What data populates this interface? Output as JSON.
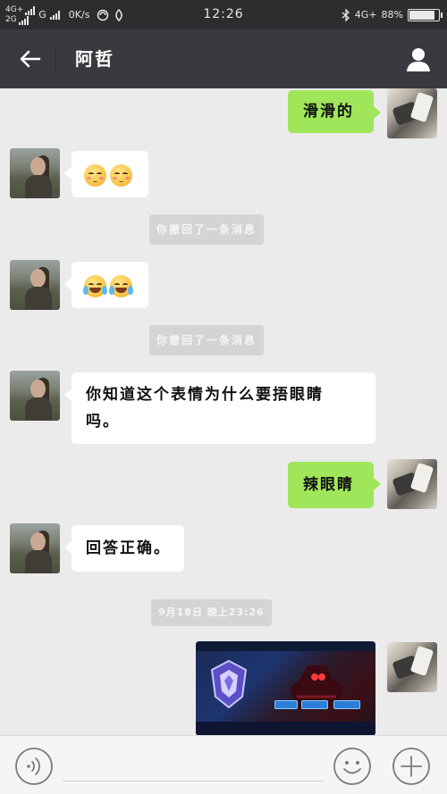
{
  "status_bar": {
    "sim1_net": "4G+",
    "sim1_sub": "2G",
    "sim2_net": "G",
    "speed": "0K/s",
    "time": "12:26",
    "right_net": "4G+",
    "battery_pct": "88%",
    "battery_level": 0.88
  },
  "header": {
    "title": "阿哲",
    "back_icon": "arrow-left-icon",
    "profile_icon": "person-icon"
  },
  "messages": [
    {
      "side": "right",
      "type": "text",
      "text": "滑滑的"
    },
    {
      "side": "left",
      "type": "emoji",
      "emojis": [
        "blushing-face",
        "blushing-face"
      ]
    },
    {
      "side": "system",
      "text": "你撤回了一条消息"
    },
    {
      "side": "left",
      "type": "emoji",
      "emojis": [
        "tears-of-joy-face",
        "tears-of-joy-face"
      ]
    },
    {
      "side": "system",
      "text": "你撤回了一条消息"
    },
    {
      "side": "left",
      "type": "text",
      "line1": "你知道这个表情为什么要捂眼睛",
      "line2": "吗。"
    },
    {
      "side": "right",
      "type": "text",
      "text": "辣眼睛"
    },
    {
      "side": "left",
      "type": "text",
      "text": "回答正确。"
    },
    {
      "side": "system",
      "text": "9月18日 晚上23:26"
    },
    {
      "side": "right",
      "type": "image",
      "description_icon": "game-screenshot-image"
    }
  ],
  "input_bar": {
    "voice_icon": "voice-icon",
    "emoji_icon": "emoji-icon",
    "plus_icon": "plus-icon"
  },
  "colors": {
    "header_bg": "#393a3f",
    "chat_bg": "#ebebeb",
    "green_bubble": "#9fe65a",
    "white_bubble": "#ffffff",
    "system_tag": "#d4d4d4"
  }
}
